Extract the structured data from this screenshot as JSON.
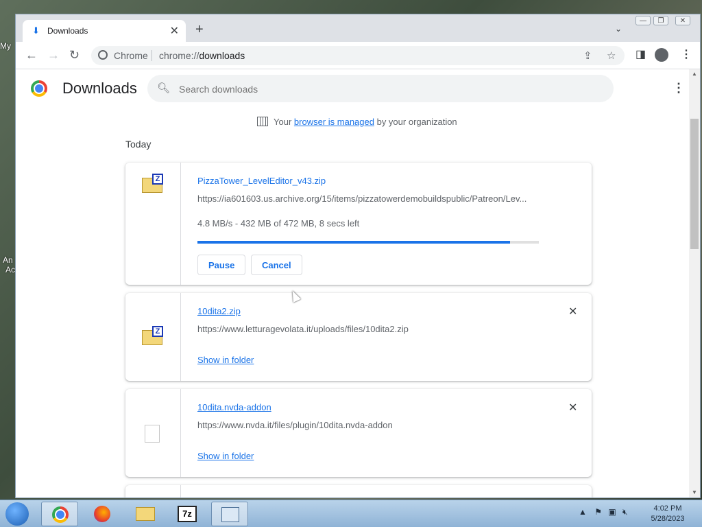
{
  "desktop": {
    "icon_labels": [
      "My",
      "An",
      "Ac"
    ]
  },
  "window": {
    "tab": {
      "title": "Downloads",
      "close": "✕"
    },
    "new_tab": "+",
    "tab_search": "⌄",
    "controls": {
      "minimize": "—",
      "restore": "❐",
      "close": "✕"
    }
  },
  "toolbar": {
    "back": "←",
    "forward": "→",
    "reload": "↻",
    "chip": "Chrome",
    "url_scheme": "chrome://",
    "url_host": "downloads"
  },
  "downloads_page": {
    "title": "Downloads",
    "search_placeholder": "Search downloads",
    "managed_prefix": "Your",
    "managed_link": "browser is managed",
    "managed_suffix": "by your organization",
    "section": "Today"
  },
  "downloads": [
    {
      "filename": "PizzaTower_LevelEditor_v43.zip",
      "url": "https://ia601603.us.archive.org/15/items/pizzatowerdemobuildspublic/Patreon/Lev...",
      "status": "4.8 MB/s - 432 MB of 472 MB, 8 secs left",
      "progress": 0.915,
      "pause_label": "Pause",
      "cancel_label": "Cancel"
    },
    {
      "filename": "10dita2.zip",
      "url": "https://www.letturagevolata.it/uploads/files/10dita2.zip",
      "show_in_folder": "Show in folder"
    },
    {
      "filename": "10dita.nvda-addon",
      "url": "https://www.nvda.it/files/plugin/10dita.nvda-addon",
      "show_in_folder": "Show in folder"
    }
  ],
  "taskbar": {
    "apps": [
      "chrome",
      "firefox",
      "file-explorer",
      "7-zip",
      "control-panel"
    ],
    "app_7z_label": "7z",
    "time": "4:02 PM",
    "date": "5/28/2023"
  },
  "colors": {
    "accent": "#1a73e8",
    "progress_fill": "#1a73e8"
  }
}
